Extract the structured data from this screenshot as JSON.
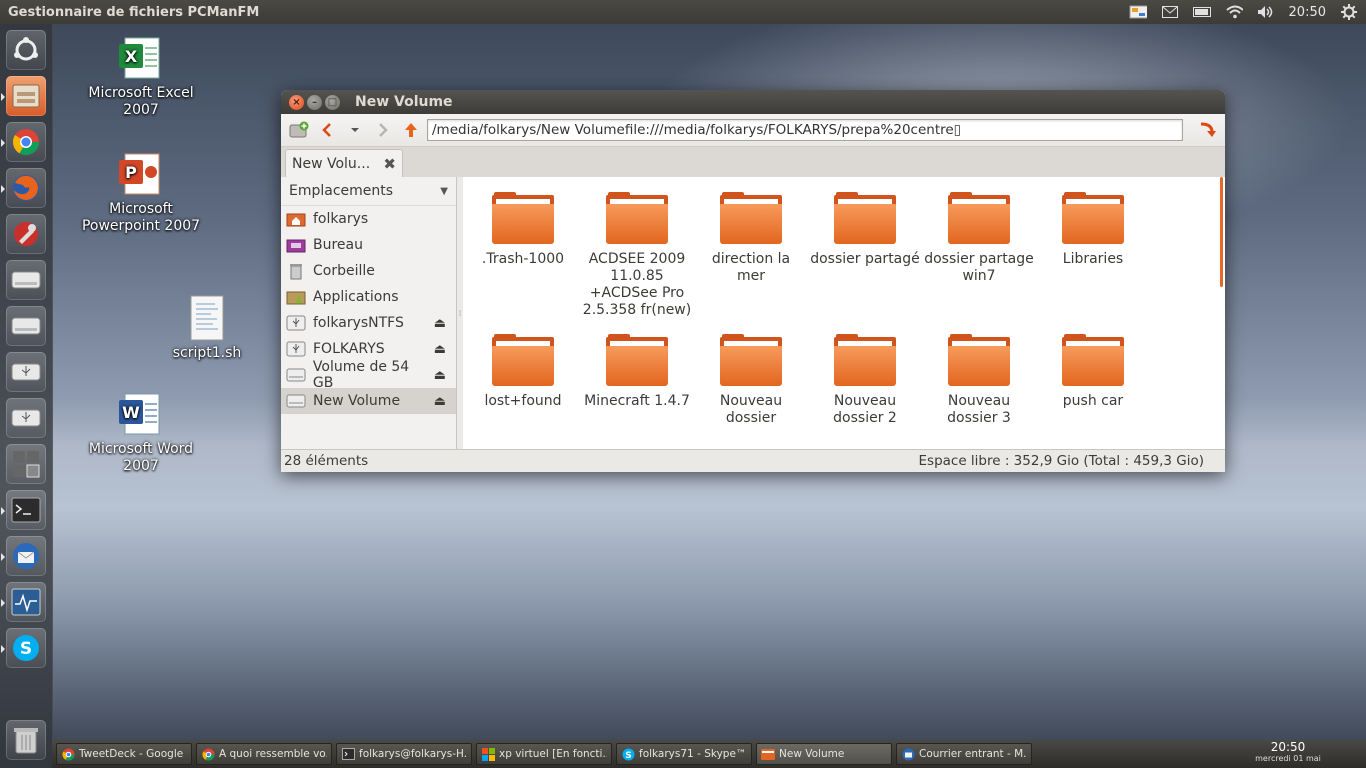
{
  "top_panel": {
    "app_title": "Gestionnaire de fichiers PCManFM",
    "time": "20:50"
  },
  "desktop_icons": [
    {
      "label": "Microsoft Excel 2007"
    },
    {
      "label": "Microsoft Powerpoint 2007"
    },
    {
      "label": "script1.sh"
    },
    {
      "label": "Microsoft Word 2007"
    }
  ],
  "window": {
    "title": "New Volume",
    "path_value": "/media/folkarys/New Volumefile:///media/folkarys/FOLKARYS/prepa%20centre▯",
    "tab_label": "New Volu...",
    "sidebar_header": "Emplacements",
    "places": [
      {
        "label": "folkarys"
      },
      {
        "label": "Bureau"
      },
      {
        "label": "Corbeille"
      },
      {
        "label": "Applications"
      },
      {
        "label": "folkarysNTFS"
      },
      {
        "label": "FOLKARYS"
      },
      {
        "label": "Volume de 54 GB"
      },
      {
        "label": "New Volume"
      }
    ],
    "files": [
      {
        "name": ".Trash-1000"
      },
      {
        "name": "ACDSEE  2009 11.0.85 +ACDSee Pro 2.5.358 fr(new)"
      },
      {
        "name": "direction la mer"
      },
      {
        "name": "dossier partagé"
      },
      {
        "name": "dossier partage win7"
      },
      {
        "name": "Libraries"
      },
      {
        "name": "lost+found"
      },
      {
        "name": "Minecraft 1.4.7"
      },
      {
        "name": "Nouveau dossier"
      },
      {
        "name": "Nouveau dossier 2"
      },
      {
        "name": "Nouveau dossier 3"
      },
      {
        "name": "push car"
      }
    ],
    "status_count": "28 éléments",
    "status_free": "Espace libre : 352,9 Gio (Total : 459,3 Gio)"
  },
  "taskbar": {
    "tasks": [
      {
        "label": "TweetDeck - Google ..."
      },
      {
        "label": "A quoi ressemble vo..."
      },
      {
        "label": "folkarys@folkarys-H..."
      },
      {
        "label": "xp virtuel [En foncti..."
      },
      {
        "label": "folkarys71 - Skype™"
      },
      {
        "label": "New Volume"
      },
      {
        "label": "Courrier entrant - M..."
      }
    ],
    "time": "20:50",
    "date": "mercredi 01 mai"
  },
  "colors": {
    "accent": "#dd4814",
    "folder": "#e2661f",
    "panel": "#3c3b37"
  }
}
